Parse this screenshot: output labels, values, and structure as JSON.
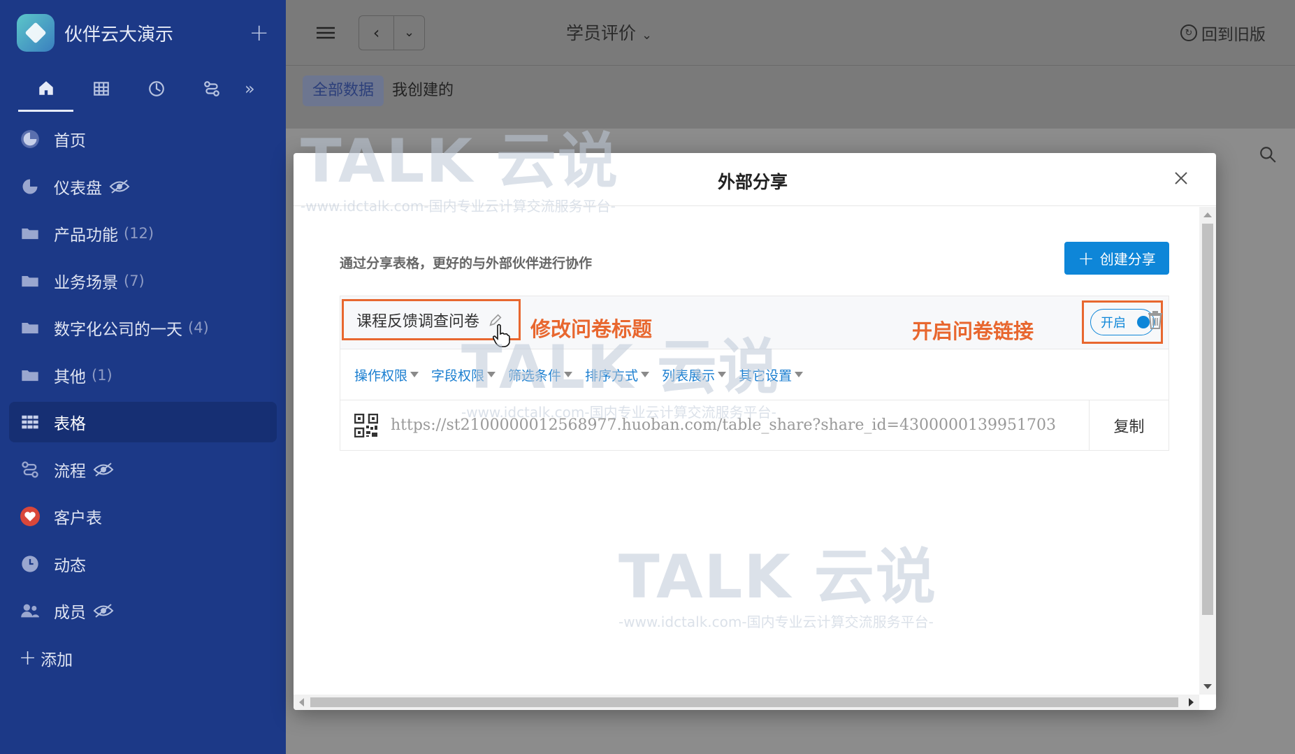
{
  "app": {
    "name": "伙伴云大演示",
    "logo_text": "伙伴云大演示"
  },
  "sidebar": {
    "tabs": [
      {
        "icon": "home-icon"
      },
      {
        "icon": "table-icon"
      },
      {
        "icon": "dashboard-icon"
      },
      {
        "icon": "flow-icon"
      }
    ],
    "more": "»",
    "items": [
      {
        "label": "首页",
        "count": "",
        "icon": "dashboard-icon"
      },
      {
        "label": "仪表盘",
        "count": "",
        "icon": "dashboard-icon",
        "hidden": true
      },
      {
        "label": "产品功能",
        "count": "(12)",
        "icon": "folder-icon"
      },
      {
        "label": "业务场景",
        "count": "(7)",
        "icon": "folder-icon"
      },
      {
        "label": "数字化公司的一天",
        "count": "(4)",
        "icon": "folder-icon"
      },
      {
        "label": "其他",
        "count": "(1)",
        "icon": "folder-icon"
      },
      {
        "label": "表格",
        "count": "",
        "icon": "table-icon",
        "active": true
      },
      {
        "label": "流程",
        "count": "",
        "icon": "flow-icon",
        "hidden": true
      },
      {
        "label": "客户表",
        "count": "",
        "icon": "heart-icon"
      },
      {
        "label": "动态",
        "count": "",
        "icon": "clock-icon"
      },
      {
        "label": "成员",
        "count": "",
        "icon": "members-icon",
        "hidden": true
      }
    ],
    "add_label": "添加"
  },
  "topbar": {
    "title": "学员评价",
    "back_old": "回到旧版"
  },
  "subtabs": [
    {
      "label": "全部数据",
      "active": true
    },
    {
      "label": "我创建的"
    }
  ],
  "modal": {
    "title": "外部分享",
    "intro": "通过分享表格，更好的与外部伙伴进行协作",
    "create_label": "创建分享",
    "share": {
      "title": "课程反馈调查问卷",
      "toggle_label": "开启",
      "options": [
        "操作权限",
        "字段权限",
        "筛选条件",
        "排序方式",
        "列表展示",
        "其它设置"
      ],
      "url": "https://st2100000012568977.huoban.com/table_share?share_id=4300000139951703",
      "copy_label": "复制"
    },
    "annotations": {
      "edit_title": "修改问卷标题",
      "enable_link": "开启问卷链接"
    }
  },
  "watermark": {
    "brand": "TALK 云说",
    "tagline": "-www.idctalk.com-国内专业云计算交流服务平台-"
  },
  "colors": {
    "sidebar": "#1c3987",
    "primary": "#0e86d8",
    "annotation": "#e8672f"
  }
}
